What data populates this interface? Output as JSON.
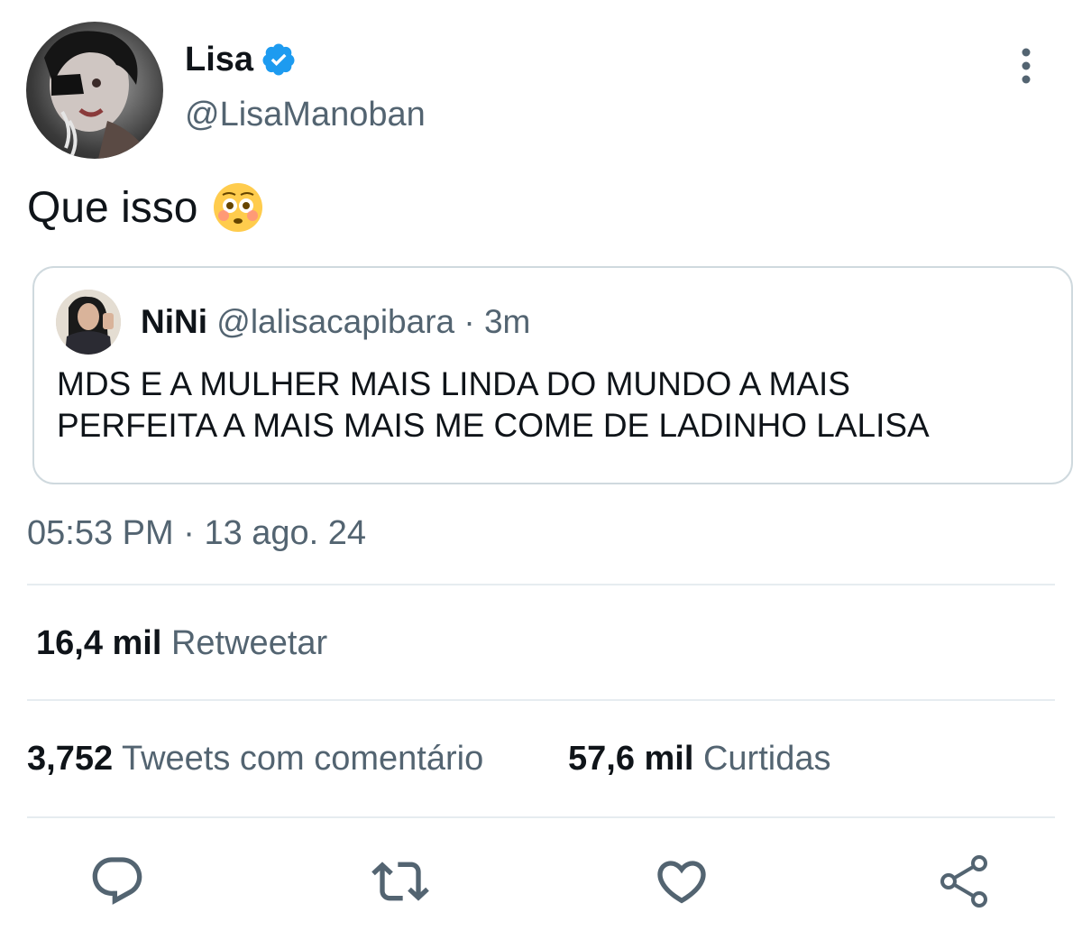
{
  "author": {
    "display_name": "Lisa",
    "handle": "@LisaManoban",
    "verified": true,
    "avatar_icon": "profile-photo"
  },
  "tweet": {
    "text": "Que isso",
    "emoji": "flushed-face-emoji"
  },
  "quoted_tweet": {
    "display_name": "NiNi",
    "handle": "@lalisacapibara",
    "separator": "·",
    "time": "3m",
    "text_line1": "MDS E A MULHER MAIS LINDA DO MUNDO A MAIS",
    "text_line2": "PERFEITA A MAIS MAIS ME COME DE LADINHO LALISA"
  },
  "timestamp": {
    "time": "05:53 PM",
    "separator": "·",
    "date": "13 ago. 24"
  },
  "stats": {
    "retweets_count": "16,4 mil",
    "retweets_label": "Retweetar",
    "quotes_count": "3,752",
    "quotes_label": "Tweets com comentário",
    "likes_count": "57,6 mil",
    "likes_label": "Curtidas"
  },
  "actions": {
    "reply_icon": "reply-icon",
    "retweet_icon": "retweet-icon",
    "like_icon": "heart-icon",
    "share_icon": "share-icon"
  },
  "colors": {
    "text_primary": "#0f1419",
    "text_secondary": "#536471",
    "verified_blue": "#1d9bf0",
    "border": "#cfd9de"
  }
}
